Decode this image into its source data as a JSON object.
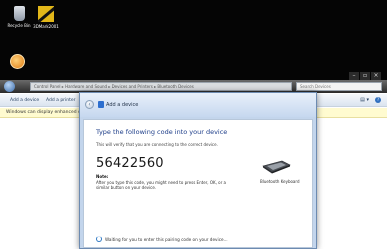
{
  "desktop": {
    "icons": [
      {
        "label": "Recycle Bin"
      },
      {
        "label": "3DMark2001"
      }
    ]
  },
  "window_controls": {
    "minimize": "–",
    "maximize": "▫",
    "close": "×"
  },
  "explorer": {
    "address": "Control Panel ▸ Hardware and Sound ▸ Devices and Printers ▸ Bluetooth Devices",
    "search_placeholder": "Search Devices",
    "commands": {
      "add_device": "Add a device",
      "add_printer": "Add a printer"
    },
    "help_label": "?",
    "view_label": "▤ ▾",
    "infobar_text": "Windows can display enhanced device"
  },
  "dialog": {
    "back_label": "‹",
    "title": "Add a device",
    "heading": "Type the following code into your device",
    "subtext": "This will verify that you are connecting to the correct device.",
    "pin": "56422560",
    "note_label": "Note:",
    "note_text": "After you type this code, you might need to press Enter, OK, or a similar button on your device.",
    "device_name": "Bluetooth Keyboard",
    "status": "Waiting for you to enter this pairing code on your device..."
  }
}
